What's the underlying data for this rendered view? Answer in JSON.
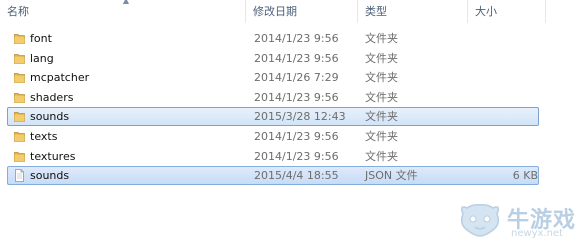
{
  "columns": {
    "name": "名称",
    "date": "修改日期",
    "type": "类型",
    "size": "大小"
  },
  "rows": [
    {
      "name": "font",
      "date": "2014/1/23 9:56",
      "type": "文件夹",
      "size": "",
      "icon": "folder-icon",
      "selected": false
    },
    {
      "name": "lang",
      "date": "2014/1/23 9:56",
      "type": "文件夹",
      "size": "",
      "icon": "folder-icon",
      "selected": false
    },
    {
      "name": "mcpatcher",
      "date": "2014/1/26 7:29",
      "type": "文件夹",
      "size": "",
      "icon": "folder-icon",
      "selected": false
    },
    {
      "name": "shaders",
      "date": "2014/1/23 9:56",
      "type": "文件夹",
      "size": "",
      "icon": "folder-icon",
      "selected": false
    },
    {
      "name": "sounds",
      "date": "2015/3/28 12:43",
      "type": "文件夹",
      "size": "",
      "icon": "folder-icon",
      "selected": true
    },
    {
      "name": "texts",
      "date": "2014/1/23 9:56",
      "type": "文件夹",
      "size": "",
      "icon": "folder-icon",
      "selected": false
    },
    {
      "name": "textures",
      "date": "2014/1/23 9:56",
      "type": "文件夹",
      "size": "",
      "icon": "folder-icon",
      "selected": false
    },
    {
      "name": "sounds",
      "date": "2015/4/4 18:55",
      "type": "JSON 文件",
      "size": "6 KB",
      "icon": "file-icon",
      "selected": true
    }
  ],
  "watermark": {
    "text": "牛游戏",
    "url": "newyx.net"
  },
  "colors": {
    "folder": "#e8b84a",
    "selection_border": "#7da2ce",
    "header_text": "#4c607a"
  }
}
